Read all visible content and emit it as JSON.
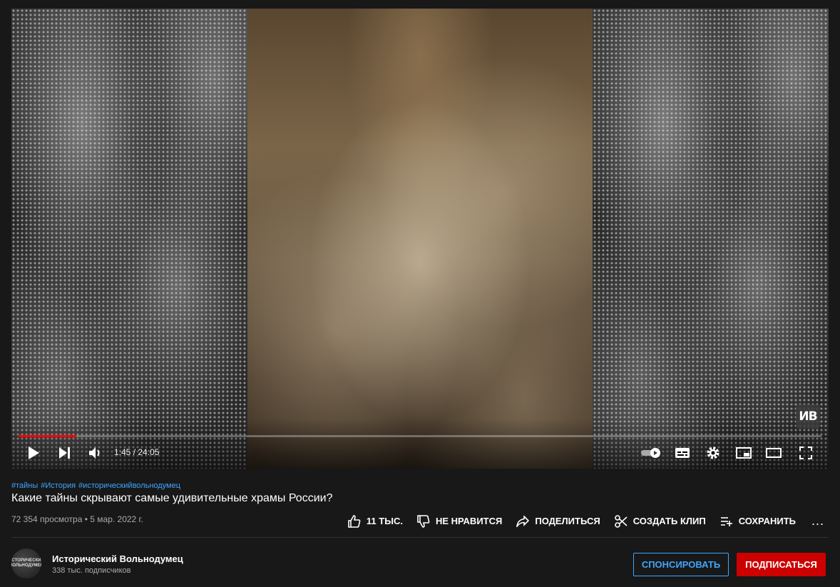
{
  "player": {
    "watermark": "ИВ",
    "progress_fraction": 0.072,
    "time_display": "1:45 / 24:05"
  },
  "video": {
    "hashtags": [
      "#тайны",
      "#История",
      "#историческийвольнодумец"
    ],
    "title": "Какие тайны скрывают самые удивительные храмы России?",
    "meta": "72 354 просмотра • 5 мар. 2022 г."
  },
  "actions": {
    "like": "11 ТЫС.",
    "dislike": "НЕ НРАВИТСЯ",
    "share": "ПОДЕЛИТЬСЯ",
    "clip": "СОЗДАТЬ КЛИП",
    "save": "СОХРАНИТЬ",
    "more": "..."
  },
  "channel": {
    "avatar_text": "ИСТОРИЧЕСКИЙ ВОЛЬНОДУМЕЦ",
    "name": "Исторический Вольнодумец",
    "subscribers": "338 тыс. подписчиков",
    "sponsor_label": "СПОНСИРОВАТЬ",
    "subscribe_label": "ПОДПИСАТЬСЯ"
  },
  "colors": {
    "accent_red": "#ff0000",
    "subscribe_red": "#cc0000",
    "link_blue": "#3ea6ff"
  }
}
